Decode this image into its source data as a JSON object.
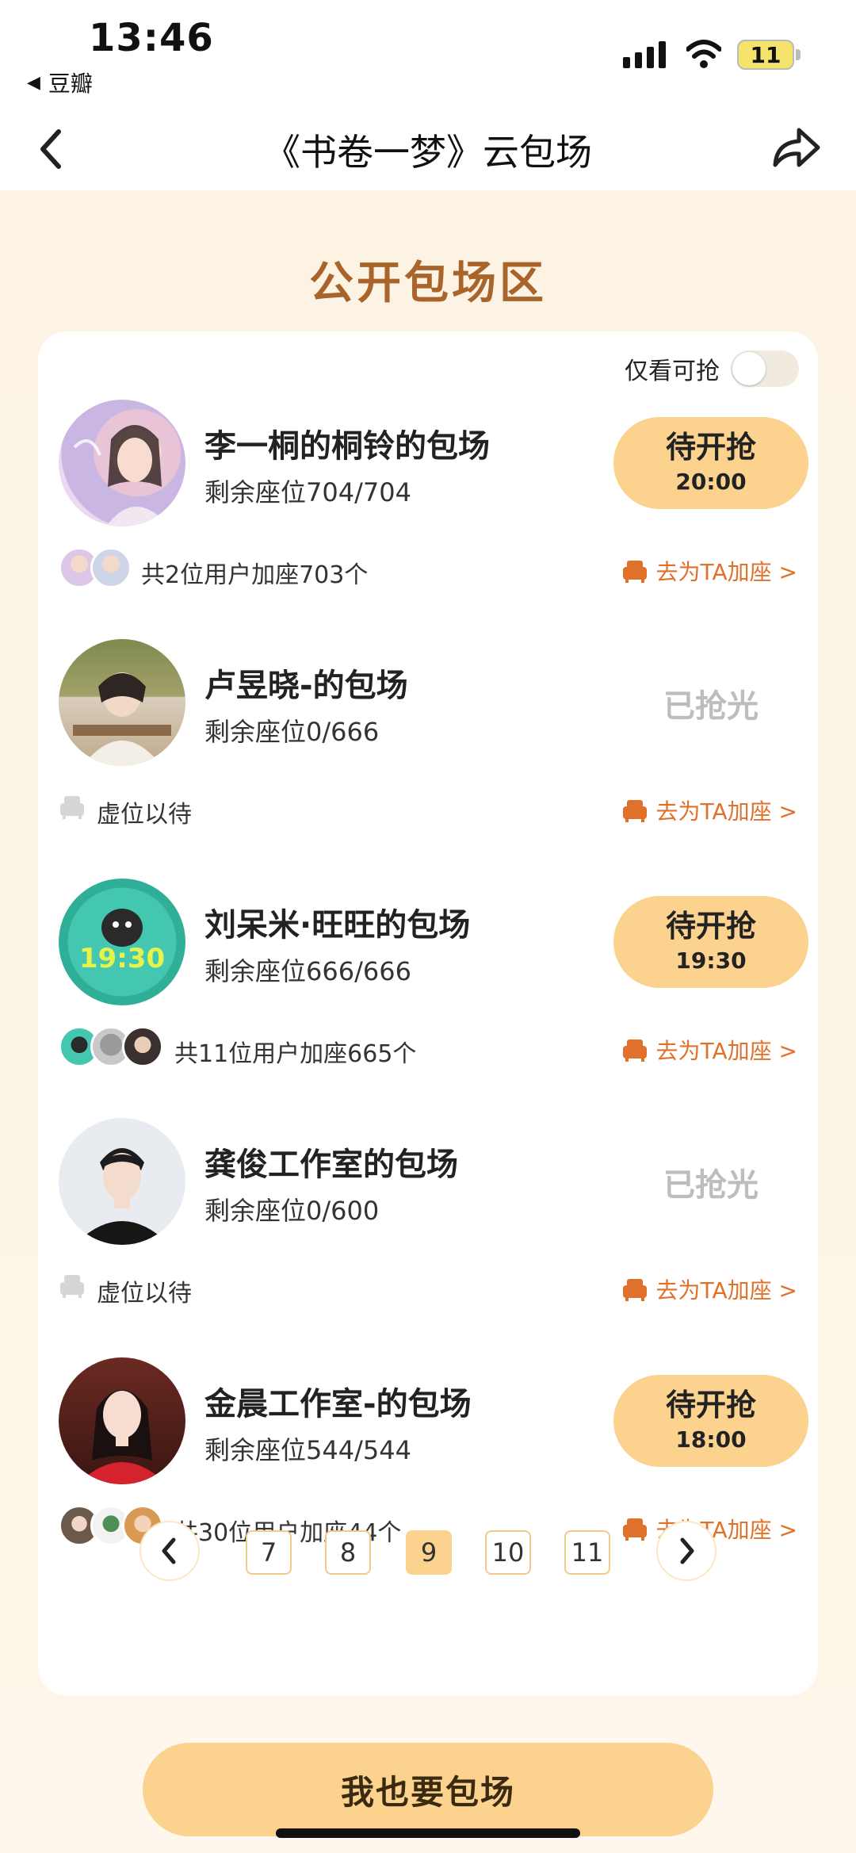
{
  "status_bar": {
    "time": "13:46",
    "back_app": "豆瓣",
    "battery": "11"
  },
  "nav": {
    "title": "《书卷一梦》云包场"
  },
  "section_title": "公开包场区",
  "filter": {
    "label": "仅看可抢",
    "enabled": false
  },
  "entries": [
    {
      "name": "李一桐的桐铃的包场",
      "seats": "剩余座位704/704",
      "state": "wait",
      "button_line1": "待开抢",
      "button_line2": "20:00",
      "summary": "共2位用户加座703个",
      "join_label": "去为TA加座 >"
    },
    {
      "name": "卢昱晓-的包场",
      "seats": "剩余座位0/666",
      "state": "soldout",
      "status_label": "已抢光",
      "summary": "虚位以待",
      "join_label": "去为TA加座 >"
    },
    {
      "name": "刘呆米·旺旺的包场",
      "seats": "剩余座位666/666",
      "state": "wait",
      "button_line1": "待开抢",
      "button_line2": "19:30",
      "summary": "共11位用户加座665个",
      "join_label": "去为TA加座 >"
    },
    {
      "name": "龚俊工作室的包场",
      "seats": "剩余座位0/600",
      "state": "soldout",
      "status_label": "已抢光",
      "summary": "虚位以待",
      "join_label": "去为TA加座 >"
    },
    {
      "name": "金晨工作室-的包场",
      "seats": "剩余座位544/544",
      "state": "wait",
      "button_line1": "待开抢",
      "button_line2": "18:00",
      "summary": "共30位用户加座44个",
      "join_label": "去为TA加座 >"
    }
  ],
  "pagination": {
    "pages": [
      "7",
      "8",
      "9",
      "10",
      "11"
    ],
    "current": "9"
  },
  "cta_label": "我也要包场",
  "colors": {
    "accent": "#FCD28F",
    "title_brown": "#A8642A",
    "link_orange": "#E0712B",
    "soldout_gray": "#BDBDBD",
    "page_bg": "#FCF5E8"
  }
}
